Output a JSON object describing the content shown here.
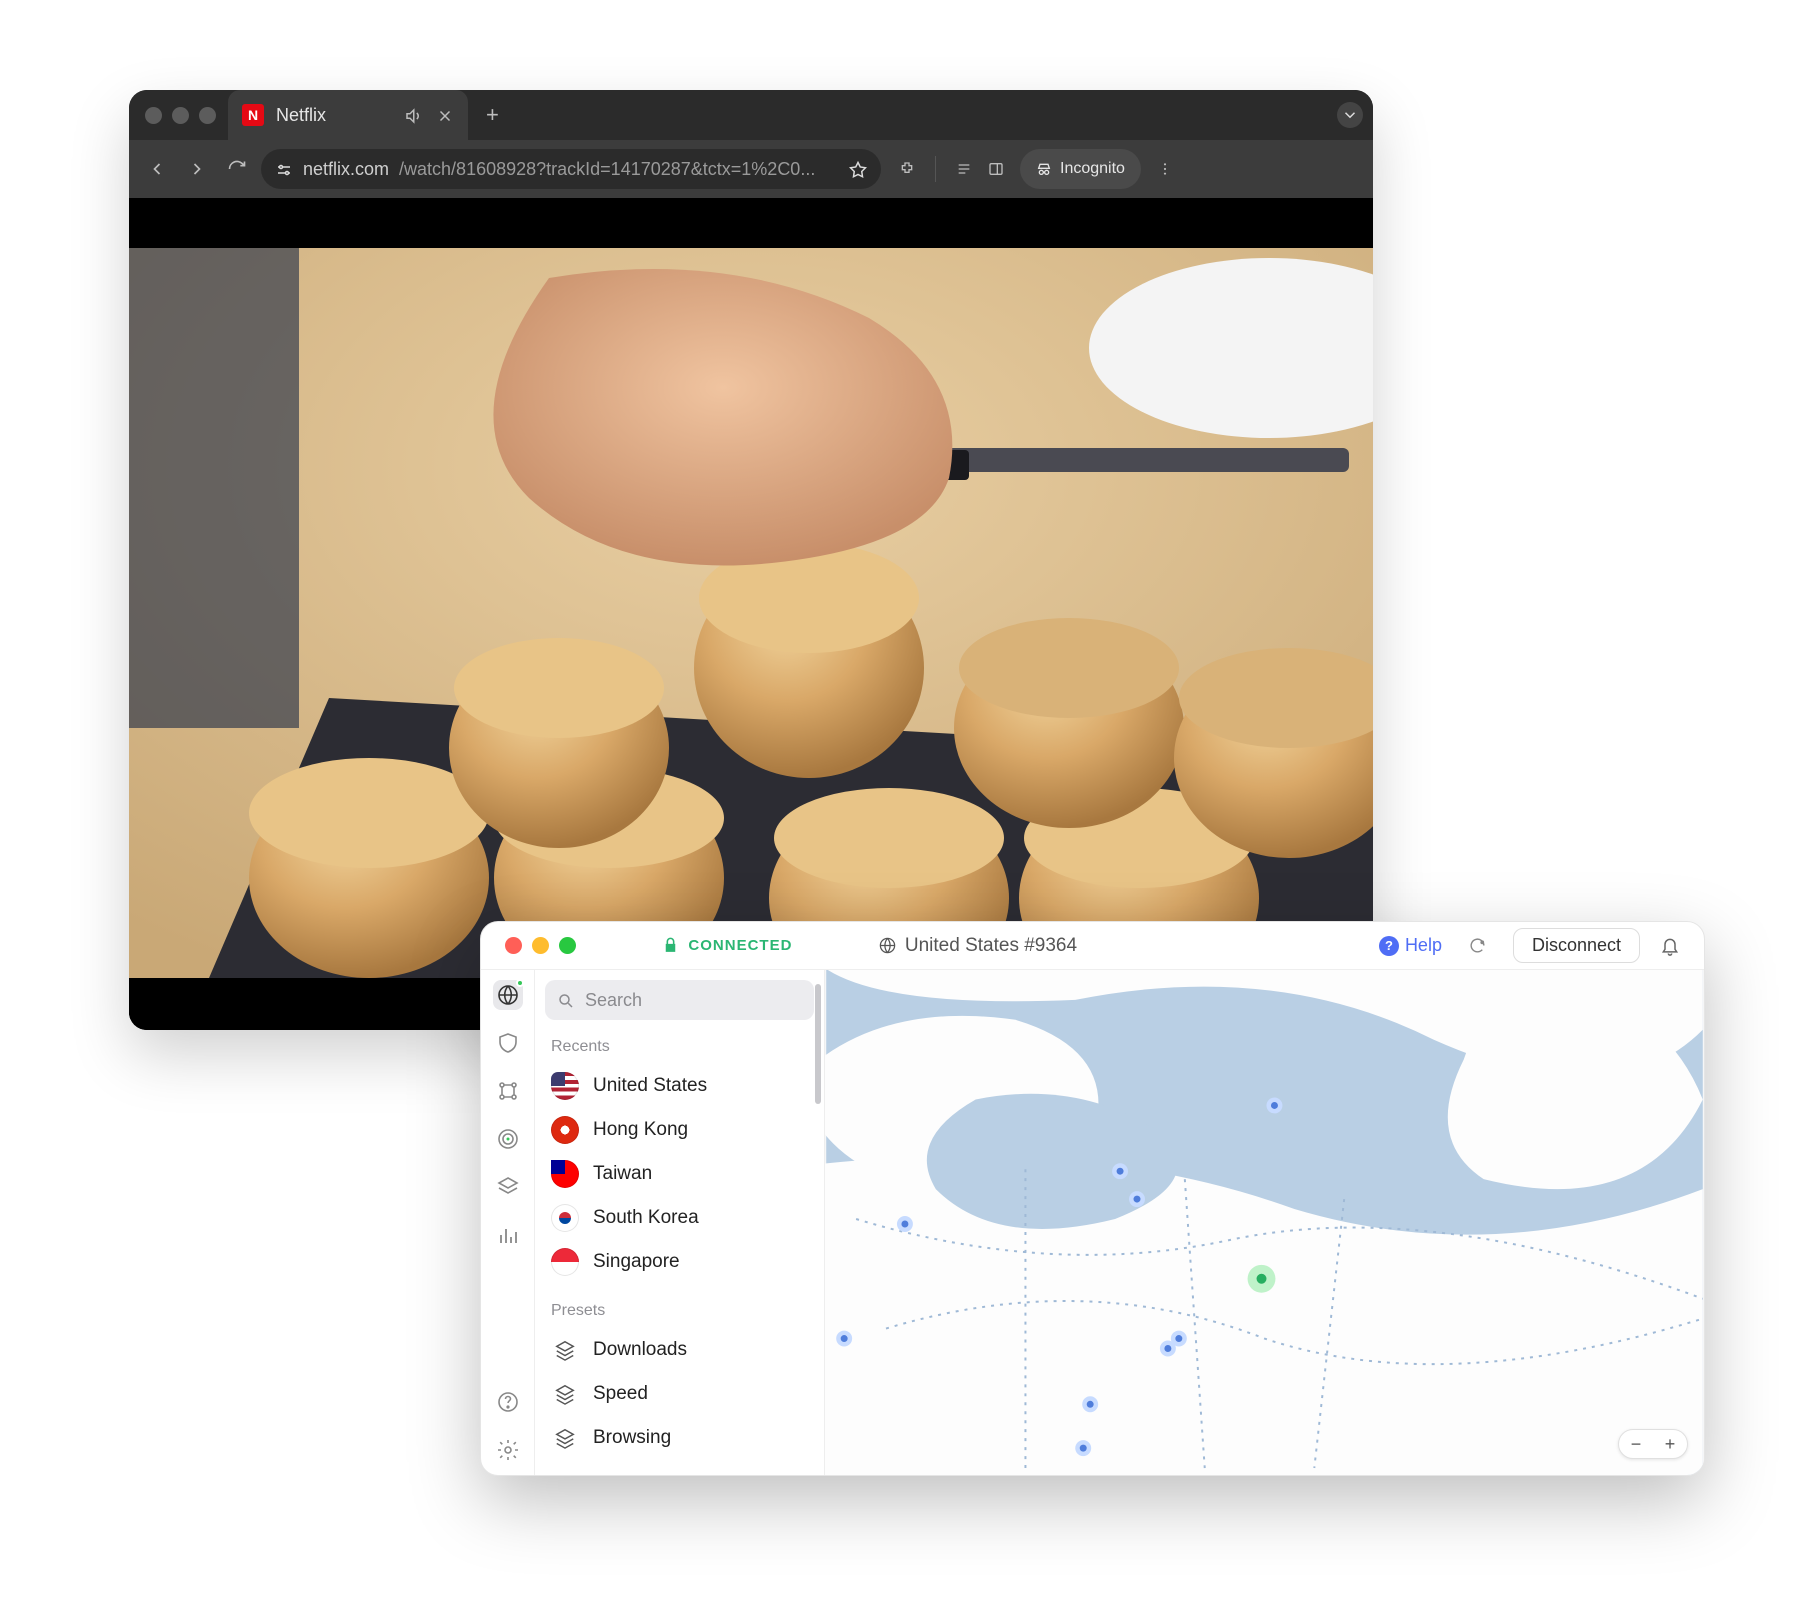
{
  "browser": {
    "tab_title": "Netflix",
    "url_host": "netflix.com",
    "url_path": "/watch/81608928?trackId=14170287&tctx=1%2C0...",
    "incognito_label": "Incognito"
  },
  "vpn": {
    "status_label": "CONNECTED",
    "server_name": "United States #9364",
    "help_label": "Help",
    "disconnect_label": "Disconnect",
    "search_placeholder": "Search",
    "recents_label": "Recents",
    "recents": [
      {
        "name": "United States",
        "flag": "us"
      },
      {
        "name": "Hong Kong",
        "flag": "hk"
      },
      {
        "name": "Taiwan",
        "flag": "tw"
      },
      {
        "name": "South Korea",
        "flag": "kr"
      },
      {
        "name": "Singapore",
        "flag": "sg"
      }
    ],
    "presets_label": "Presets",
    "presets": [
      {
        "name": "Downloads"
      },
      {
        "name": "Speed"
      },
      {
        "name": "Browsing"
      }
    ],
    "zoom_out": "−",
    "zoom_in": "+"
  }
}
